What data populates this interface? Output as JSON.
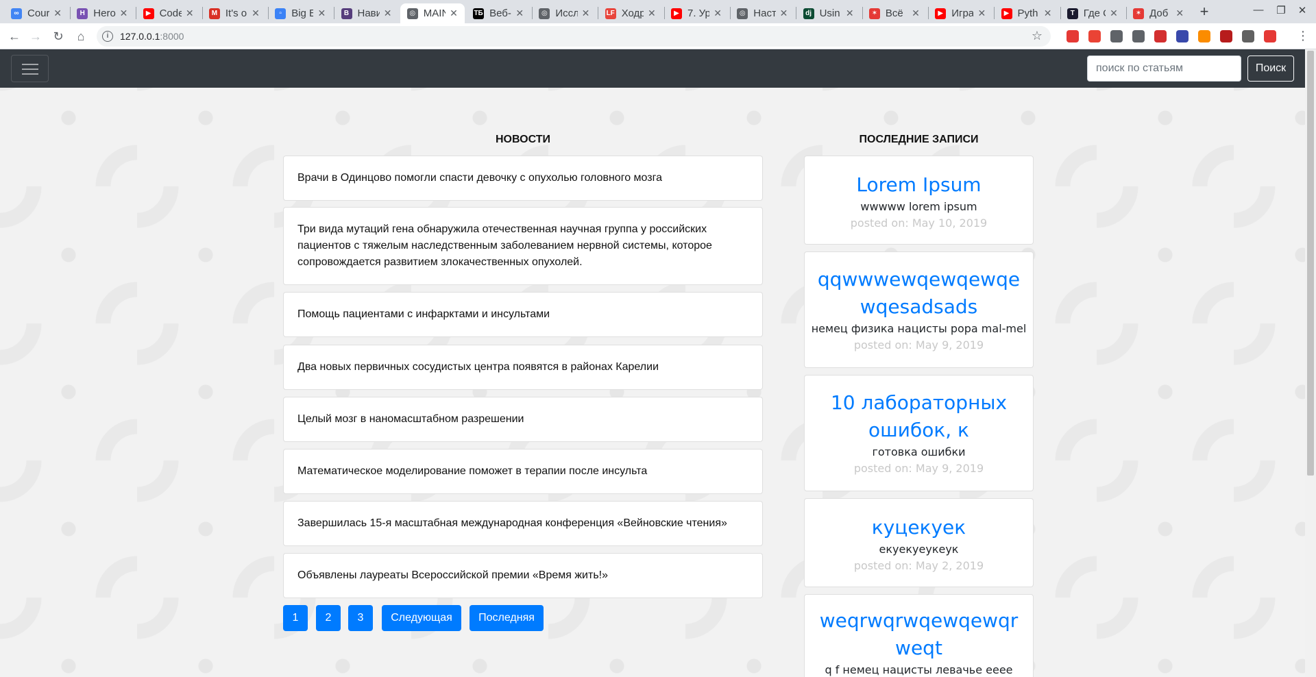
{
  "browser": {
    "tabs": [
      {
        "label": "Cour",
        "fav_color": "#4285f4",
        "fav_char": "∞"
      },
      {
        "label": "Hero",
        "fav_color": "#7952b3",
        "fav_char": "H"
      },
      {
        "label": "Code",
        "fav_color": "#ff0000",
        "fav_char": "▶"
      },
      {
        "label": "It's o",
        "fav_color": "#d93025",
        "fav_char": "M"
      },
      {
        "label": "Big E",
        "fav_color": "#3b82f6",
        "fav_char": "▫"
      },
      {
        "label": "Нави",
        "fav_color": "#563d7c",
        "fav_char": "B"
      },
      {
        "label": "MAIN",
        "fav_color": "#5f6368",
        "fav_char": "◎"
      },
      {
        "label": "Веб-",
        "fav_color": "#000000",
        "fav_char": "ТБ"
      },
      {
        "label": "Иссл",
        "fav_color": "#5f6368",
        "fav_char": "◎"
      },
      {
        "label": "Ходр",
        "fav_color": "#e8453c",
        "fav_char": "LF"
      },
      {
        "label": "7. Ур",
        "fav_color": "#ff0000",
        "fav_char": "▶"
      },
      {
        "label": "Наст",
        "fav_color": "#5f6368",
        "fav_char": "◎"
      },
      {
        "label": "Usin",
        "fav_color": "#0c4b33",
        "fav_char": "dj"
      },
      {
        "label": "Всё",
        "fav_color": "#e53935",
        "fav_char": "✶"
      },
      {
        "label": "Игра",
        "fav_color": "#ff0000",
        "fav_char": "▶"
      },
      {
        "label": "Pyth",
        "fav_color": "#ff0000",
        "fav_char": "▶"
      },
      {
        "label": "Где С",
        "fav_color": "#1a1a2e",
        "fav_char": "T"
      },
      {
        "label": "Доб",
        "fav_color": "#e53935",
        "fav_char": "✶"
      }
    ],
    "url_host": "127.0.0.1",
    "url_port": ":8000",
    "extensions": [
      "#e53935",
      "#ea4335",
      "#5f6368",
      "#5f6368",
      "#d32f2f",
      "#3949ab",
      "#fb8c00",
      "#b71c1c",
      "#616161",
      "#e53935"
    ]
  },
  "navbar": {
    "search_placeholder": "поиск по статьям",
    "search_button": "Поиск"
  },
  "news": {
    "title": "НОВОСТИ",
    "items": [
      "Врачи в Одинцово помогли спасти девочку с опухолью головного мозга",
      "Три вида мутаций гена обнаружила отечественная научная группа у российских пациентов с тяжелым наследственным заболеванием нервной системы, которое сопровождается развитием злокачественных опухолей.",
      "Помощь пациентами с инфарктами и инсультами",
      "Два новых первичных сосудистых центра появятся в районах Карелии",
      "Целый мозг в наномасштабном разрешении",
      "Математическое моделирование поможет в терапии после инсульта",
      "Завершилась 15-я масштабная международная конференция «Вейновские чтения»",
      "Объявлены лауреаты Всероссийской премии «Время жить!»"
    ],
    "pagination": [
      "1",
      "2",
      "3",
      "Следующая",
      "Последняя"
    ]
  },
  "posts": {
    "title": "ПОСЛЕДНИЕ ЗАПИСИ",
    "items": [
      {
        "title": "Lorem Ipsum",
        "desc": "wwwww lorem ipsum",
        "date": "posted on: May 10, 2019"
      },
      {
        "title": "qqwwwewqewqewqewqesadsads",
        "desc": "немец физика нацисты popa mal-mel",
        "date": "posted on: May 9, 2019"
      },
      {
        "title": "10 лабораторных ошибок, к",
        "desc": "готовка ошибки",
        "date": "posted on: May 9, 2019"
      },
      {
        "title": "куцекуек",
        "desc": "екуекуеукеук",
        "date": "posted on: May 2, 2019"
      },
      {
        "title": "weqrwqrwqewqewqrweqt",
        "desc": "q f немец нацисты левачье eeee",
        "date": ""
      }
    ]
  }
}
